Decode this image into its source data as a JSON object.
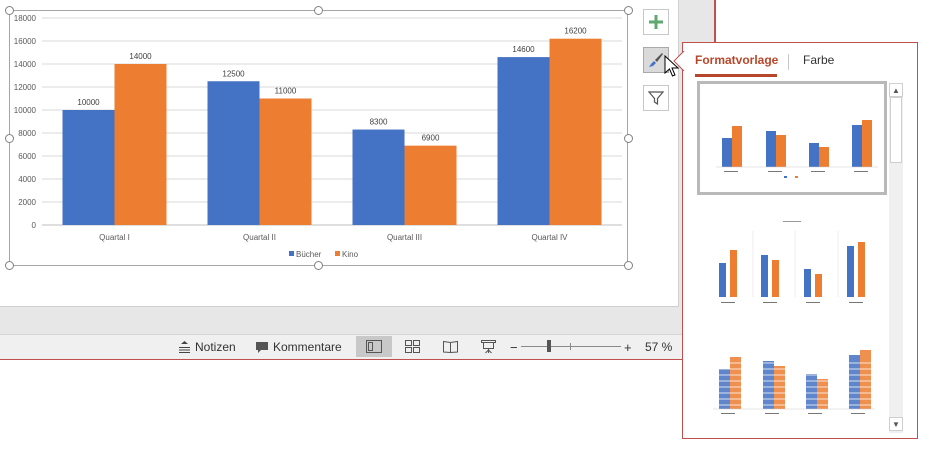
{
  "chart_data": {
    "type": "bar",
    "categories": [
      "Quartal I",
      "Quartal II",
      "Quartal III",
      "Quartal IV"
    ],
    "series": [
      {
        "name": "Bücher",
        "values": [
          10000,
          12500,
          8300,
          14600
        ],
        "color": "#4472c4"
      },
      {
        "name": "Kino",
        "values": [
          14000,
          11000,
          6900,
          16200
        ],
        "color": "#ed7d31"
      }
    ],
    "ylim": [
      0,
      18000
    ],
    "yticks": [
      0,
      2000,
      4000,
      6000,
      8000,
      10000,
      12000,
      14000,
      16000,
      18000
    ],
    "grid": true,
    "legend": "bottom",
    "title": "",
    "xlabel": "",
    "ylabel": ""
  },
  "chart_tools": {
    "add_icon": "plus-icon",
    "style_icon": "paintbrush-icon",
    "filter_icon": "filter-icon"
  },
  "statusbar": {
    "notes_label": "Notizen",
    "comments_label": "Kommentare",
    "zoom_minus": "−",
    "zoom_plus": "+",
    "zoom_value": "57 %"
  },
  "format_pane": {
    "tabs": [
      "Formatvorlage",
      "Farbe"
    ],
    "active_tab": "Formatvorlage",
    "accent_color": "#b7472a"
  }
}
